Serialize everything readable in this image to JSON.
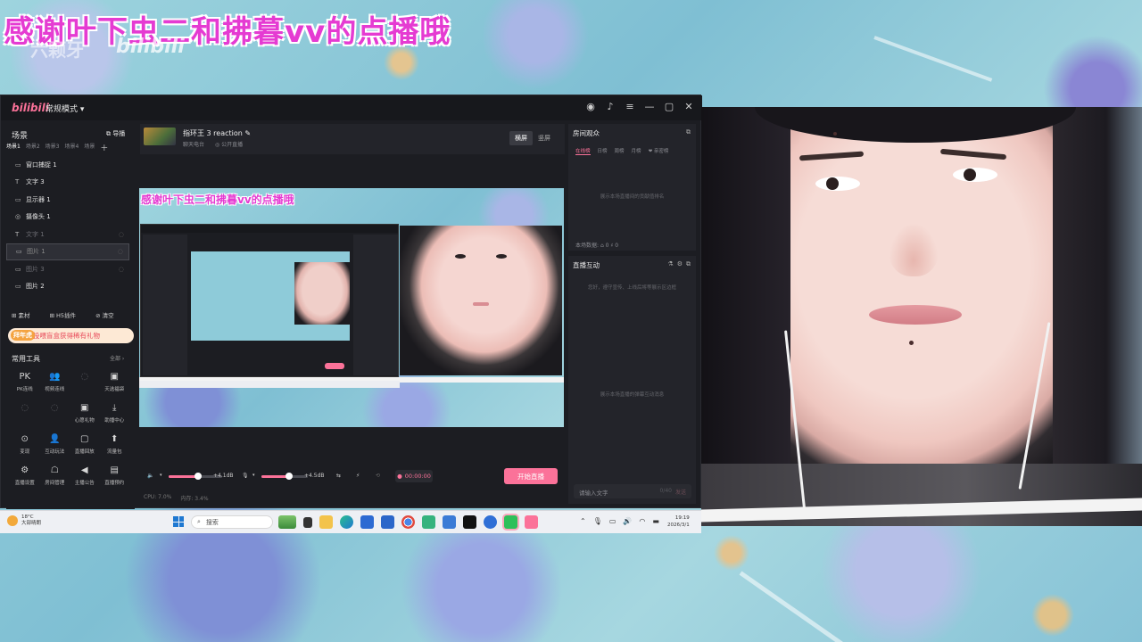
{
  "overlay": {
    "title": "感谢叶下虫二和拂暮vv的点播哦",
    "watermark": "六颗牙",
    "platform_logo": "bilibili"
  },
  "app": {
    "logo": "bilibili",
    "mode": "常规模式 ▾",
    "left": {
      "scenes_title": "场景",
      "import_label": "导播",
      "scene_tabs": [
        "场景1",
        "场景2",
        "场景3",
        "场景4",
        "场景"
      ],
      "sources": [
        {
          "label": "窗口捕捉 1",
          "icon": "▭",
          "state": "normal"
        },
        {
          "label": "文字 3",
          "icon": "T",
          "state": "normal"
        },
        {
          "label": "显示器 1",
          "icon": "▭",
          "state": "normal"
        },
        {
          "label": "摄像头 1",
          "icon": "◎",
          "state": "normal"
        },
        {
          "label": "文字 1",
          "icon": "T",
          "state": "dim"
        },
        {
          "label": "图片 1",
          "icon": "▭",
          "state": "selected"
        },
        {
          "label": "图片 3",
          "icon": "▭",
          "state": "dim"
        },
        {
          "label": "图片 2",
          "icon": "▭",
          "state": "normal"
        }
      ],
      "bottom_actions": [
        "⊞ 素材",
        "⊞ H5插件",
        "⊘ 清空"
      ],
      "promo_tag": "拜年虎",
      "promo_text": "投喂盲盒获得稀有礼物",
      "tools_title": "常用工具",
      "tools_all": "全部 ›",
      "tools": [
        {
          "icon": "PK",
          "label": "PK连线",
          "dim": false
        },
        {
          "icon": "👥",
          "label": "视频连线",
          "dim": false
        },
        {
          "icon": "◌",
          "label": "",
          "dim": true
        },
        {
          "icon": "▣",
          "label": "天选福袋",
          "dim": false
        },
        {
          "icon": "◌",
          "label": "",
          "dim": true
        },
        {
          "icon": "◌",
          "label": "",
          "dim": true
        },
        {
          "icon": "▣",
          "label": "心愿礼物",
          "dim": false
        },
        {
          "icon": "⤓",
          "label": "助播中心",
          "dim": false
        },
        {
          "icon": "⊙",
          "label": "变现",
          "dim": false
        },
        {
          "icon": "👤",
          "label": "互动玩法",
          "dim": false
        },
        {
          "icon": "▢",
          "label": "直播回放",
          "dim": false
        },
        {
          "icon": "⬆",
          "label": "流量包",
          "dim": false
        },
        {
          "icon": "⚙",
          "label": "直播设置",
          "dim": false
        },
        {
          "icon": "☖",
          "label": "房间管理",
          "dim": false
        },
        {
          "icon": "◀",
          "label": "主播公告",
          "dim": false
        },
        {
          "icon": "▤",
          "label": "直播预约",
          "dim": false
        }
      ]
    },
    "stream": {
      "title": "指环王 3 reaction",
      "category": "聊天电台",
      "visibility": "公开直播",
      "orient_landscape": "横屏",
      "orient_portrait": "竖屏"
    },
    "preview_title": "感谢叶下虫二和拂暮vv的点播哦",
    "controls": {
      "speaker_db": "+4.1dB",
      "mic_db": "+4.5dB",
      "speaker_level": 0.55,
      "mic_level": 0.6,
      "timer": "00:00:00",
      "start_label": "开始直播"
    },
    "status": {
      "cpu": "CPU: 7.0%",
      "memory": "内存: 3.4%"
    },
    "audience": {
      "title": "房间观众",
      "tabs": [
        "在线榜",
        "日榜",
        "周榜",
        "月榜",
        "❤ 亲密榜"
      ],
      "empty": "展示本场直播间的贡献值排名",
      "stats_label": "本场数据:",
      "stats_viewers": "⌂ 0",
      "stats_likes": "♯ 0"
    },
    "interaction": {
      "title": "直播互动",
      "notice": "您好，遵守宣传、上线后将等展示区边框",
      "empty": "展示本场直播的弹幕互动消息",
      "input_placeholder": "请输入文字",
      "char_count": "0/40",
      "send_label": "发送"
    }
  },
  "taskbar": {
    "weather_temp": "18°C",
    "weather_desc": "大部晴朗",
    "search_placeholder": "搜索",
    "time": "19:19",
    "date": "2026/3/1"
  },
  "colors": {
    "accent": "#fb7299",
    "overlay_title": "#e53bd2",
    "panel": "#23242a",
    "window": "#1c1d22"
  }
}
